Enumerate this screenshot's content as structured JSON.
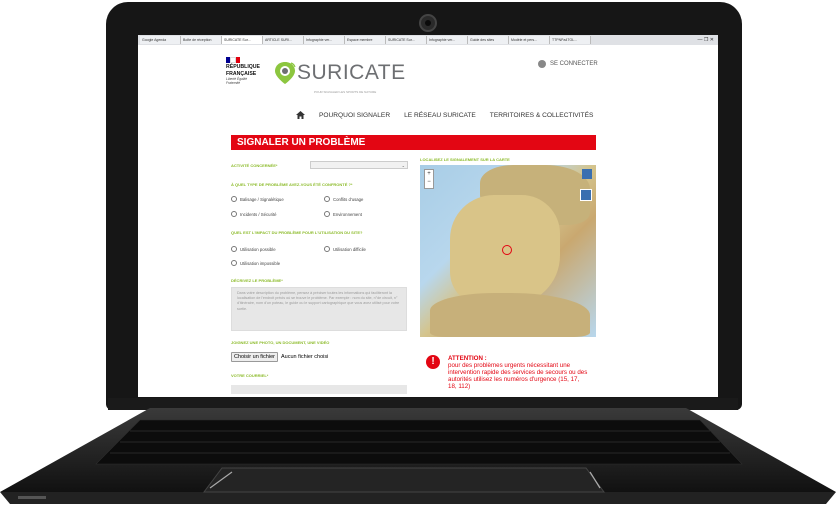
{
  "browser": {
    "tabs": [
      "Google Agenda",
      "Boîte de réception",
      "SURICATE Sur...",
      "ARTICLE SURI...",
      "Infographie ver...",
      "Espace membre",
      "SURICATE Sur...",
      "Infographie ver...",
      "Guide des sites",
      "Modèle et pers...",
      "TTPNPa4TOL..."
    ],
    "window_controls": "—  ❐  ✕"
  },
  "republique": {
    "line1": "RÉPUBLIQUE",
    "line2": "FRANÇAISE",
    "motto": "Liberté Égalité Fraternité"
  },
  "brand": {
    "name": "SURICATE",
    "tagline": "POUR SIGNALER LES SPORTS DE NATURE"
  },
  "header": {
    "login_label": "SE CONNECTER"
  },
  "nav": {
    "items": [
      "POURQUOI SIGNALER",
      "LE RÉSEAU SURICATE",
      "TERRITOIRES & COLLECTIVITÉS"
    ]
  },
  "form": {
    "title": "SIGNALER UN PROBLÈME",
    "activity_label": "ACTIVITÉ CONCERNÉE*",
    "activity_value": "⌄",
    "problem_type_label": "À QUEL TYPE DE PROBLÈME AVEZ-VOUS ÉTÉ CONFRONTÉ ?*",
    "problem_types": [
      "Balisage / Signalétique",
      "Conflits d'usage",
      "Incidents / Sécurité",
      "Environnement"
    ],
    "impact_label": "QUEL EST L'IMPACT DU PROBLÈME POUR L'UTILISATION DU SITE?",
    "impacts": [
      "Utilisation possible",
      "Utilisation difficile",
      "Utilisation impossible"
    ],
    "describe_label": "DÉCRIVEZ LE PROBLÈME*",
    "describe_placeholder": "Dans votre description du problème, pensez à préciser toutes les informations qui faciliteront la localisation de l'endroit précis où se trouve le problème. Par exemple : nom du site, n°de circuit, n° d'itinéraire, nom d'un poteau, le guide ou le support cartographique que vous avez utilisé pour votre sortie.",
    "attach_label": "JOIGNEZ UNE PHOTO, UN DOCUMENT, UNE VIDÉO",
    "choose_file": "Choisir un fichier",
    "no_file": "Aucun fichier choisi",
    "email_label": "VOTRE COURRIEL*"
  },
  "map": {
    "label": "LOCALISEZ LE SIGNALEMENT SUR LA CARTE",
    "zoom_in": "+",
    "zoom_out": "−"
  },
  "alert": {
    "icon": "!",
    "title": "ATTENTION :",
    "text": "pour des problèmes urgents nécessitant une intervention rapide des services de secours ou des autorités utilisez les numéros d'urgence (15, 17, 18, 112)"
  },
  "colors": {
    "accent_red": "#e30613",
    "label_green": "#8cbb2a",
    "brand_grey": "#6d6f72",
    "logo_green": "#8cc63f"
  }
}
